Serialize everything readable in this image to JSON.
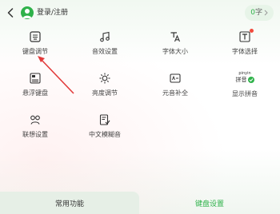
{
  "header": {
    "back_icon": "chevron-left-icon",
    "avatar_icon": "user-avatar-icon",
    "login_label": "登录/注册",
    "word_count_value": "0",
    "word_count_unit": "字",
    "word_count_chevron": "chevron-right-icon"
  },
  "grid": {
    "rows": [
      [
        {
          "label": "键盘调节",
          "icon": "keyboard-adjust-icon"
        },
        {
          "label": "音效设置",
          "icon": "music-note-icon"
        },
        {
          "label": "字体大小",
          "icon": "font-size-icon"
        },
        {
          "label": "字体选择",
          "icon": "font-select-icon",
          "badge": true
        }
      ],
      [
        {
          "label": "悬浮键盘",
          "icon": "floating-keyboard-icon"
        },
        {
          "label": "亮度调节",
          "icon": "brightness-icon"
        },
        {
          "label": "元音补全",
          "icon": "vowel-complete-icon"
        },
        {
          "label": "显示拼音",
          "icon": "show-pinyin-icon",
          "pinyin_top": "pinyin",
          "pinyin_bottom": "拼音"
        }
      ],
      [
        {
          "label": "联想设置",
          "icon": "association-settings-icon"
        },
        {
          "label": "中文模糊音",
          "icon": "fuzzy-sound-icon"
        }
      ]
    ]
  },
  "bottom_tabs": {
    "common": "常用功能",
    "keyboard": "键盘设置"
  },
  "colors": {
    "accent": "#2fb24a",
    "badge": "#f24a3c",
    "arrow": "#e23b3b"
  }
}
